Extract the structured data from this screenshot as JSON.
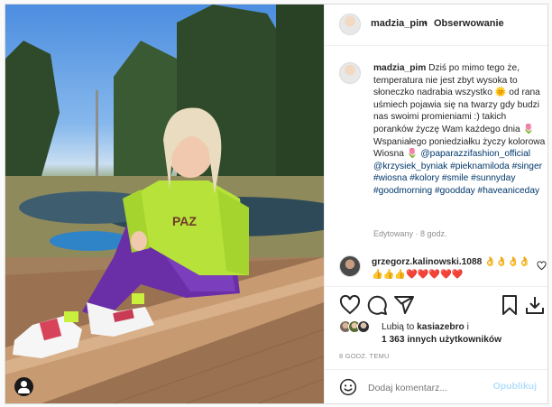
{
  "post": {
    "username": "madzia_pim",
    "separator": "•",
    "follow_label": "Obserwowanie",
    "caption": {
      "username": "madzia_pim",
      "text": "Dziś po mimo tego że, temperatura nie jest zbyt wysoka to słoneczko nadrabia wszystko 🌞 od rana uśmiech pojawia się na twarzy gdy budzi nas swoimi promieniami :) takich poranków życzę Wam każdego dnia 🌷 Wspaniałego poniedziałku życzy kolorowa Wiosna 🌷",
      "tags": "@paparazzifashion_official @krzysiek_byniak #pieknamiloda #singer #wiosna #kolory #smile #sunnyday #goodmorning #goodday #haveaniceday",
      "meta": "Edytowany · 8 godz."
    },
    "comment": {
      "username": "grzegorz.kalinowski.1088",
      "text": "👌👌👌👌👍👍👍❤️❤️❤️❤️❤️"
    },
    "likes": {
      "prefix": "Lubią to",
      "first_user": "kasiazebro",
      "connector": "i",
      "others": "1 363 innych użytkowników"
    },
    "timestamp": "8 GODZ. TEMU",
    "add_comment": {
      "placeholder": "Dodaj komentarz...",
      "post_label": "Opublikuj"
    },
    "icons": [
      "heart-icon",
      "comment-icon",
      "share-icon",
      "bookmark-icon",
      "download-icon",
      "emoji-icon",
      "user-tag-icon"
    ],
    "colors": {
      "link": "#00376b",
      "post_disabled": "#b2dffc",
      "muted": "#8e8e8e"
    }
  }
}
